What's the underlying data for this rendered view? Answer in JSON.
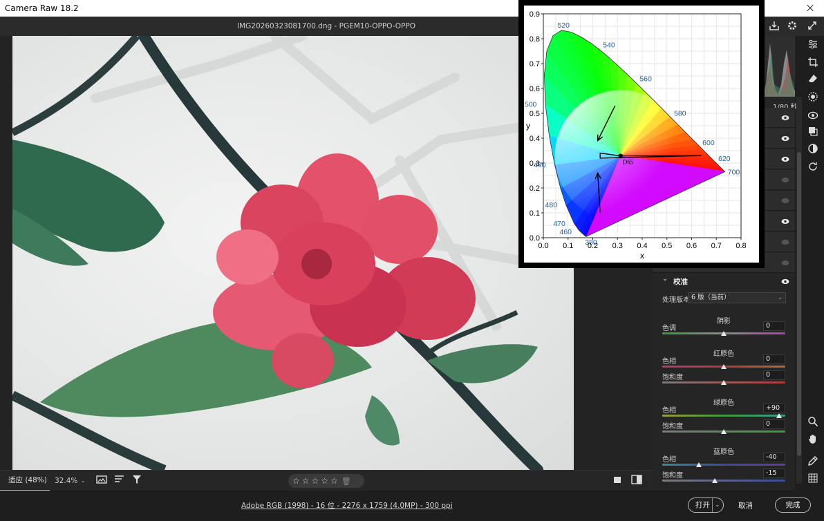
{
  "window": {
    "title": "Camera Raw 18.2"
  },
  "file": {
    "name": "IMG20260323081700.dng - PGEM10-OPPO-OPPO"
  },
  "toolbar": {
    "zoom_fit": "适应 (48%)",
    "zoom_value": "32.4%",
    "stars": "☆☆☆☆☆"
  },
  "status": {
    "info_link": "Adobe RGB (1998) - 16 位 - 2276 x 1759 (4.0MP) - 300 ppi",
    "open_label": "打开",
    "cancel_label": "取消",
    "done_label": "完成"
  },
  "panel": {
    "shutter": "1/80 秒",
    "section_title": "校准",
    "process_label": "处理版本",
    "process_value": "6 版（当前）",
    "groups": {
      "shadows": {
        "title": "阴影",
        "tint_label": "色调",
        "tint_value": "0",
        "tint": 0
      },
      "red": {
        "title": "红原色",
        "hue_label": "色相",
        "hue_value": "0",
        "hue": 0,
        "sat_label": "饱和度",
        "sat_value": "0",
        "sat": 0
      },
      "green": {
        "title": "绿原色",
        "hue_label": "色相",
        "hue_value": "+90",
        "hue": 90,
        "sat_label": "饱和度",
        "sat_value": "0",
        "sat": 0
      },
      "blue": {
        "title": "蓝原色",
        "hue_label": "色相",
        "hue_value": "-40",
        "hue": -40,
        "sat_label": "饱和度",
        "sat_value": "-15",
        "sat": -15
      }
    }
  },
  "icons": {
    "filebar": [
      "export-icon",
      "gear-icon",
      "expand-icon"
    ],
    "right_column": [
      "sliders-icon",
      "crop-icon",
      "eraser-icon",
      "mask-icon",
      "redeye-icon",
      "presets-icon",
      "snapshot-icon",
      "sync-icon",
      "zoom-icon",
      "hand-icon",
      "eyedropper-icon",
      "grid-icon"
    ]
  },
  "chart_data": {
    "type": "scatter",
    "xlabel": "x",
    "ylabel": "y",
    "xlim": [
      0,
      0.8
    ],
    "ylim": [
      0,
      0.9
    ],
    "xticks": [
      "0.0",
      "0.1",
      "0.2",
      "0.3",
      "0.4",
      "0.5",
      "0.6",
      "0.7",
      "0.8"
    ],
    "yticks": [
      "0.0",
      "0.1",
      "0.2",
      "0.3",
      "0.4",
      "0.5",
      "0.6",
      "0.7",
      "0.8",
      "0.9"
    ],
    "grid": true,
    "wavelength_labels": [
      {
        "label": "520",
        "x": 0.074,
        "y": 0.834
      },
      {
        "label": "540",
        "x": 0.23,
        "y": 0.754
      },
      {
        "label": "560",
        "x": 0.373,
        "y": 0.624
      },
      {
        "label": "580",
        "x": 0.512,
        "y": 0.487
      },
      {
        "label": "600",
        "x": 0.627,
        "y": 0.372
      },
      {
        "label": "620",
        "x": 0.691,
        "y": 0.308
      },
      {
        "label": "700",
        "x": 0.735,
        "y": 0.265
      },
      {
        "label": "500",
        "x": 0.008,
        "y": 0.538
      },
      {
        "label": "490",
        "x": 0.045,
        "y": 0.295
      },
      {
        "label": "480",
        "x": 0.091,
        "y": 0.133
      },
      {
        "label": "470",
        "x": 0.124,
        "y": 0.058
      },
      {
        "label": "460",
        "x": 0.144,
        "y": 0.03
      },
      {
        "label": "380",
        "x": 0.174,
        "y": 0.005
      }
    ],
    "white_point": {
      "label": "D65",
      "x": 0.3127,
      "y": 0.329
    },
    "gamut_wedge": [
      [
        0.3127,
        0.329
      ],
      [
        0.23,
        0.34
      ],
      [
        0.23,
        0.32
      ],
      [
        0.64,
        0.33
      ]
    ],
    "arrows": [
      {
        "from": [
          0.29,
          0.53
        ],
        "to": [
          0.22,
          0.39
        ]
      },
      {
        "from": [
          0.23,
          0.1
        ],
        "to": [
          0.22,
          0.26
        ]
      }
    ]
  }
}
